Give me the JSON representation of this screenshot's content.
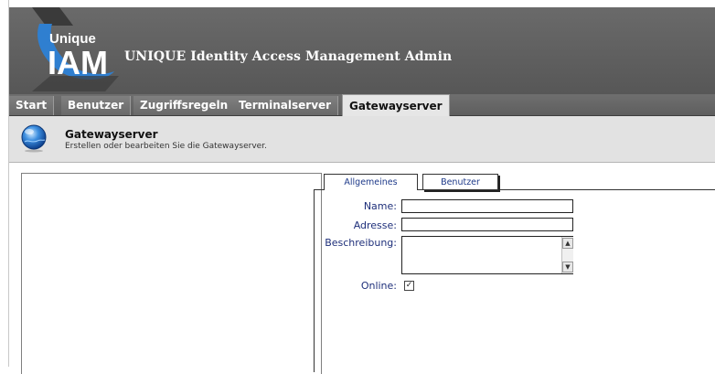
{
  "header": {
    "logo_line1": "Unique",
    "logo_line2": "IAM",
    "title": "UNIQUE Identity Access Management Admin"
  },
  "tabs": [
    {
      "label": "Start"
    },
    {
      "label": "Benutzer"
    },
    {
      "label": "Zugriffsregeln"
    },
    {
      "label": "Terminalserver"
    },
    {
      "label": "Gatewayserver",
      "active": true
    }
  ],
  "section": {
    "icon": "globe-icon",
    "title": "Gatewayserver",
    "subtitle": "Erstellen oder bearbeiten Sie die Gatewayserver."
  },
  "form": {
    "tabs": [
      {
        "label": "Allgemeines",
        "active": true
      },
      {
        "label": "Benutzer",
        "active": false
      }
    ],
    "fields": {
      "name_label": "Name:",
      "name_value": "",
      "address_label": "Adresse:",
      "address_value": "",
      "description_label": "Beschreibung:",
      "description_value": "",
      "online_label": "Online:",
      "online_checked": true
    }
  },
  "colors": {
    "header_bg": "#5f5f5f",
    "label_text": "#1e2f7a",
    "logo_blue": "#2f7fd0"
  }
}
